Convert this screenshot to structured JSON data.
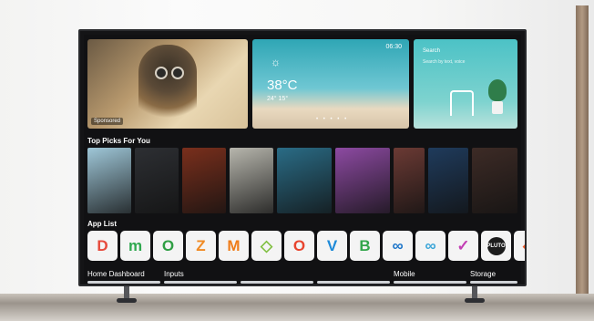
{
  "hero": {
    "sponsored": "Sponsored",
    "weather": {
      "icon": "sun-icon",
      "temp": "38°C",
      "range": "24° 15°",
      "time": "06:30",
      "dots": "• • • • •"
    },
    "search": {
      "label": "Search",
      "sub": "Search by text, voice"
    }
  },
  "sections": {
    "top_picks": "Top Picks For You",
    "app_list": "App List",
    "home_dashboard": "Home Dashboard",
    "inputs": "Inputs",
    "mobile": "Mobile",
    "storage": "Storage"
  },
  "apps": [
    {
      "glyph": "D",
      "color": "#e64a3c"
    },
    {
      "glyph": "m",
      "color": "#2fa84f"
    },
    {
      "glyph": "O",
      "color": "#2f9e44"
    },
    {
      "glyph": "Z",
      "color": "#f08a24"
    },
    {
      "glyph": "M",
      "color": "#ef7d1a"
    },
    {
      "glyph": "◇",
      "color": "#7fbf3f"
    },
    {
      "glyph": "O",
      "color": "#e8442e"
    },
    {
      "glyph": "V",
      "color": "#1e8ad8"
    },
    {
      "glyph": "B",
      "color": "#33a64b"
    },
    {
      "glyph": "∞",
      "color": "#1a73c8"
    },
    {
      "glyph": "∞",
      "color": "#3aa5d8"
    },
    {
      "glyph": "✓",
      "color": "#c33fb4"
    },
    {
      "glyph": "PLUTO",
      "color": "#1c1c1c"
    },
    {
      "glyph": "◆",
      "color": "#f05a28"
    }
  ],
  "picks": [
    "#9fc7d8",
    "#2d2f33",
    "#7a2f1c",
    "#b7b6ad",
    "#2a6c86",
    "#8d4aa2",
    "#6b3a34",
    "#1f3b5c",
    "#3d2b26"
  ]
}
